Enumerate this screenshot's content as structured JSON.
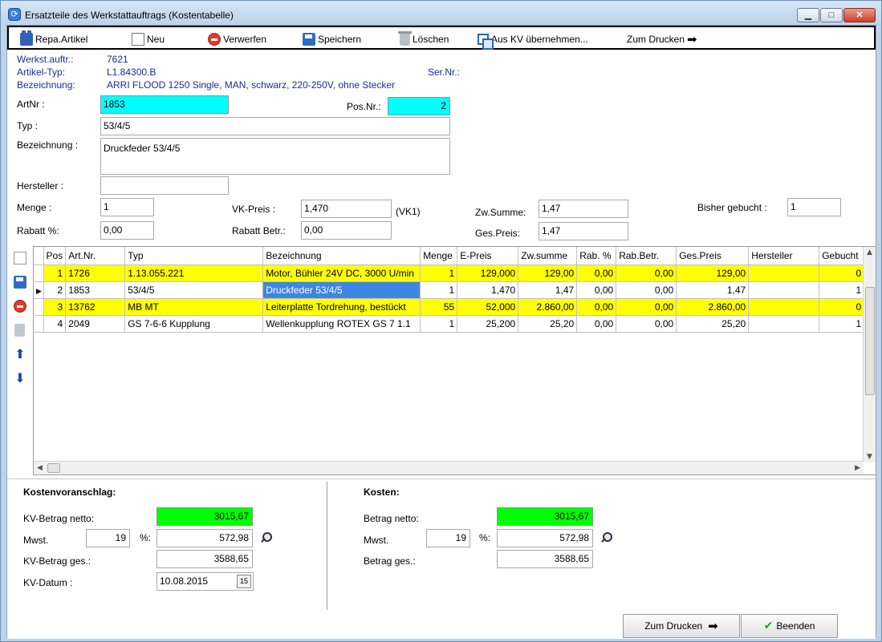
{
  "window": {
    "title": "Ersatzteile des Werkstattauftrags (Kostentabelle)"
  },
  "toolbar": {
    "repa_label": "Repa.Artikel",
    "new_label": "Neu",
    "discard_label": "Verwerfen",
    "save_label": "Speichern",
    "delete_label": "Löschen",
    "from_kv_label": "Aus KV übernehmen...",
    "print_label": "Zum Drucken"
  },
  "order_info": {
    "order_label": "Werkst.auftr.:",
    "order_value": "7621",
    "type_label": "Artikel-Typ:",
    "type_value": "L1.84300.B",
    "serial_label": "Ser.Nr.:",
    "desc_label": "Bezeichnung:",
    "desc_value": "ARRI FLOOD 1250 Single, MAN, schwarz, 220-250V, ohne Stecker"
  },
  "form": {
    "artnr_label": "ArtNr :",
    "artnr_value": "1853",
    "posnr_label": "Pos.Nr.:",
    "posnr_value": "2",
    "typ_label": "Typ :",
    "typ_value": "53/4/5",
    "bez_label": "Bezeichnung :",
    "bez_value": "Druckfeder 53/4/5",
    "hersteller_label": "Hersteller :",
    "hersteller_value": "",
    "menge_label": "Menge :",
    "menge_value": "1",
    "vkpreis_label": "VK-Preis :",
    "vkpreis_value": "1,470",
    "vk_suffix": "(VK1)",
    "zwsumme_label": "Zw.Summe:",
    "zwsumme_value": "1,47",
    "bisher_label": "Bisher gebucht :",
    "bisher_value": "1",
    "rabatt_label": "Rabatt %:",
    "rabatt_value": "0,00",
    "rabattbetr_label": "Rabatt Betr.:",
    "rabattbetr_value": "0,00",
    "gespreis_label": "Ges.Preis:",
    "gespreis_value": "1,47"
  },
  "grid": {
    "columns": [
      "Pos",
      "Art.Nr.",
      "Typ",
      "Bezeichnung",
      "Menge",
      "E-Preis",
      "Zw.summe",
      "Rab. %",
      "Rab.Betr.",
      "Ges.Preis",
      "Hersteller",
      "Gebucht"
    ],
    "rows": [
      [
        "1",
        "1726",
        "1.13.055.221",
        "Motor, Bühler 24V DC, 3000 U/min",
        "1",
        "129,000",
        "129,00",
        "0,00",
        "0,00",
        "129,00",
        "",
        "0"
      ],
      [
        "2",
        "1853",
        "53/4/5",
        "Druckfeder 53/4/5",
        "1",
        "1,470",
        "1,47",
        "0,00",
        "0,00",
        "1,47",
        "",
        "1"
      ],
      [
        "3",
        "13762",
        "MB MT",
        "Leiterplatte Tordrehung, bestückt",
        "55",
        "52,000",
        "2.860,00",
        "0,00",
        "0,00",
        "2.860,00",
        "",
        "0"
      ],
      [
        "4",
        "2049",
        "GS 7-6-6 Kupplung",
        "Wellenkupplung ROTEX GS 7 1.1",
        "1",
        "25,200",
        "25,20",
        "0,00",
        "0,00",
        "25,20",
        "",
        "1"
      ]
    ],
    "highlight_color": "#ffff00",
    "selected_color": "#3e87e0"
  },
  "kv": {
    "title": "Kostenvoranschlag:",
    "netto_label": "KV-Betrag netto:",
    "netto_value": "3015,67",
    "mwst_label": "Mwst.",
    "mwst_rate": "19",
    "percent_label": "%:",
    "mwst_value": "572,98",
    "ges_label": "KV-Betrag ges.:",
    "ges_value": "3588,65",
    "datum_label": "KV-Datum :",
    "datum_value": "10.08.2015",
    "calendar_day": "15"
  },
  "kosten": {
    "title": "Kosten:",
    "netto_label": "Betrag netto:",
    "netto_value": "3015,67",
    "mwst_label": "Mwst.",
    "mwst_rate": "19",
    "percent_label": "%:",
    "mwst_value": "572,98",
    "ges_label": "Betrag ges.:",
    "ges_value": "3588,65"
  },
  "footer": {
    "print_label": "Zum Drucken",
    "close_label": "Beenden"
  }
}
